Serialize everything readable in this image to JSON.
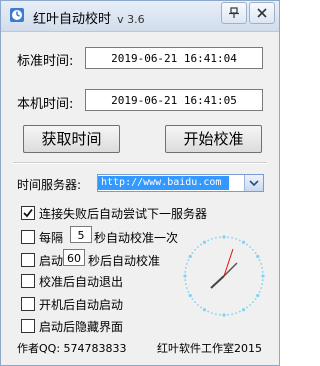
{
  "window": {
    "title": "红叶自动校时",
    "version": "v 3.6"
  },
  "times": {
    "standard_label": "标准时间:",
    "standard_value": "2019-06-21  16:41:04",
    "local_label": "本机时间:",
    "local_value": "2019-06-21  16:41:05"
  },
  "buttons": {
    "fetch": "获取时间",
    "calibrate": "开始校准"
  },
  "server": {
    "label": "时间服务器:",
    "value": "http://www.baidu.com"
  },
  "options": {
    "failover": "连接失败后自动尝试下一服务器",
    "interval_prefix": "每隔",
    "interval_value": "5",
    "interval_suffix": "秒自动校准一次",
    "startup_prefix": "启动",
    "startup_value": "60",
    "startup_suffix": "秒后自动校准",
    "exit_after": "校准后自动退出",
    "autostart": "开机后自动启动",
    "hide_ui": "启动后隐藏界面"
  },
  "checkbox_states": {
    "failover": true,
    "interval": false,
    "startup": false,
    "exit_after": false,
    "autostart": false,
    "hide_ui": false
  },
  "footer": {
    "author": "作者QQ: 574783833",
    "studio": "红叶软件工作室2015"
  },
  "colors": {
    "accent": "#3399ff",
    "clock_ticks": "#7fd3f0",
    "second_hand": "#e01010"
  },
  "icons": [
    "app-icon",
    "pin-icon",
    "close-icon",
    "dropdown-arrow-icon",
    "checkmark-icon",
    "clock-icon"
  ]
}
